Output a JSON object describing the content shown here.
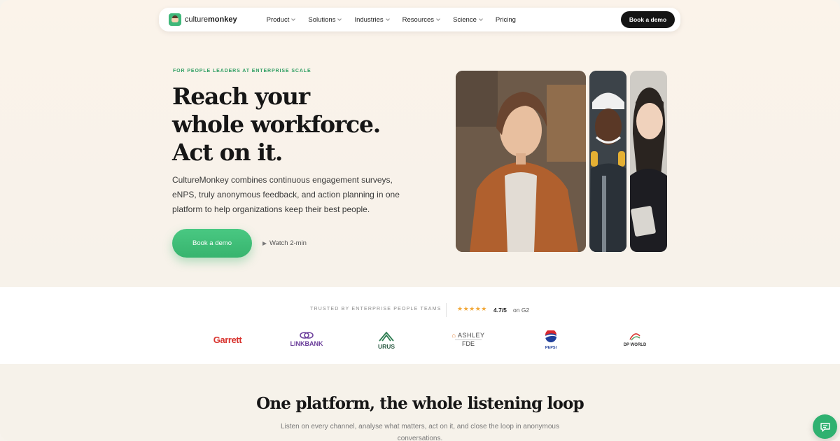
{
  "nav": {
    "brand_light": "culture",
    "brand_bold": "monkey",
    "items": [
      {
        "label": "Product",
        "dropdown": true
      },
      {
        "label": "Solutions",
        "dropdown": true
      },
      {
        "label": "Industries",
        "dropdown": true
      },
      {
        "label": "Resources",
        "dropdown": true
      },
      {
        "label": "Science",
        "dropdown": true
      },
      {
        "label": "Pricing",
        "dropdown": false
      }
    ],
    "cta_label": "Book a demo"
  },
  "hero": {
    "eyebrow": "FOR PEOPLE LEADERS AT ENTERPRISE SCALE",
    "headline_1": "Reach your",
    "headline_2": "whole workforce.",
    "headline_3": "Act on it.",
    "description": "CultureMonkey combines continuous engagement surveys, eNPS, truly anonymous feedback, and action planning in one platform to help organizations keep their best people.",
    "cta_label": "Book a demo",
    "watch_label": "Watch 2-min"
  },
  "trust": {
    "label": "TRUSTED BY ENTERPRISE PEOPLE TEAMS",
    "stars": "★★★★★",
    "rating": "4.7/5",
    "rating_source": "on G2",
    "logos": [
      "Garrett",
      "LINKBANK",
      "URUS",
      "ASHLEY",
      "FDE",
      "PEPSI",
      "DP WORLD"
    ]
  },
  "section": {
    "title": "One platform, the whole listening loop",
    "subtitle": "Listen on every channel, analyse what matters, act on it, and close the loop in anonymous conversations."
  },
  "colors": {
    "accent": "#3fb779",
    "dark": "#141414",
    "eyebrow": "#2f9e63",
    "star": "#f2a93b"
  }
}
